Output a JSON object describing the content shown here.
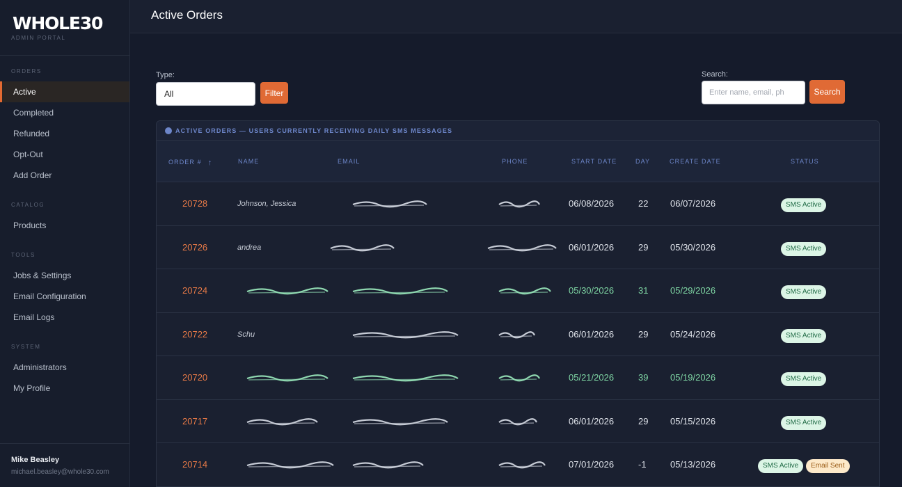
{
  "brand": {
    "logo": "WHOLE30",
    "subtitle": "ADMIN PORTAL"
  },
  "sidebar": {
    "sections": [
      {
        "title": "ORDERS",
        "items": [
          {
            "label": "Active",
            "active": true
          },
          {
            "label": "Completed"
          },
          {
            "label": "Refunded"
          },
          {
            "label": "Opt-Out"
          },
          {
            "label": "Add Order"
          }
        ]
      },
      {
        "title": "CATALOG",
        "items": [
          {
            "label": "Products"
          }
        ]
      },
      {
        "title": "TOOLS",
        "items": [
          {
            "label": "Jobs & Settings"
          },
          {
            "label": "Email Configuration"
          },
          {
            "label": "Email Logs"
          }
        ]
      },
      {
        "title": "SYSTEM",
        "items": [
          {
            "label": "Administrators"
          },
          {
            "label": "My Profile"
          }
        ]
      }
    ],
    "user": {
      "name": "Mike Beasley",
      "email": "michael.beasley@whole30.com"
    }
  },
  "header": {
    "title": "Active Orders"
  },
  "filters": {
    "type_label": "Type:",
    "type_value": "All",
    "filter_button": "Filter",
    "search_label": "Search:",
    "search_placeholder": "Enter name, email, ph",
    "search_button": "Search"
  },
  "table": {
    "title": "ACTIVE ORDERS — USERS CURRENTLY RECEIVING DAILY SMS MESSAGES",
    "columns": [
      "ORDER #",
      "NAME",
      "EMAIL",
      "PHONE",
      "START DATE",
      "DAY",
      "CREATE DATE",
      "STATUS"
    ],
    "accent_color": "#6d86c9",
    "rows": [
      {
        "order": "20728",
        "name": "Johnson, Jessica",
        "start": "06/08/2026",
        "day": "22",
        "created": "06/07/2026",
        "status": [
          "SMS Active"
        ]
      },
      {
        "order": "20726",
        "name": "andrea",
        "start": "06/01/2026",
        "day": "29",
        "created": "05/30/2026",
        "status": [
          "SMS Active"
        ]
      },
      {
        "order": "20724",
        "name": "",
        "start": "05/30/2026",
        "day": "31",
        "created": "05/29/2026",
        "status": [
          "SMS Active"
        ]
      },
      {
        "order": "20722",
        "name": "Schu",
        "start": "06/01/2026",
        "day": "29",
        "created": "05/24/2026",
        "status": [
          "SMS Active"
        ]
      },
      {
        "order": "20720",
        "name": "",
        "start": "05/21/2026",
        "day": "39",
        "created": "05/19/2026",
        "status": [
          "SMS Active"
        ]
      },
      {
        "order": "20717",
        "name": "",
        "start": "06/01/2026",
        "day": "29",
        "created": "05/15/2026",
        "status": [
          "SMS Active"
        ]
      },
      {
        "order": "20714",
        "name": "",
        "start": "07/01/2026",
        "day": "-1",
        "created": "05/13/2026",
        "status": [
          "SMS Active",
          "Email Sent"
        ]
      }
    ]
  },
  "colors": {
    "accent": "#e06a35",
    "link": "#e87a47",
    "highlight": "#7fd6a4"
  }
}
